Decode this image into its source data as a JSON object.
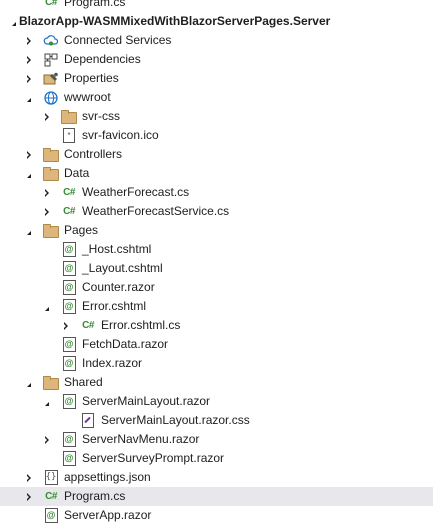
{
  "solution_explorer": {
    "items": [
      {
        "label": "Program.cs",
        "depth": 1,
        "icon": "csharp-file-icon",
        "expander": "none"
      },
      {
        "label": "BlazorApp-WASMMixedWithBlazorServerPages.Server",
        "depth": 0,
        "icon": "project-icon",
        "expander": "expanded",
        "bold": true
      },
      {
        "label": "Connected Services",
        "depth": 1,
        "icon": "connected-services-icon",
        "expander": "collapsed"
      },
      {
        "label": "Dependencies",
        "depth": 1,
        "icon": "dependencies-icon",
        "expander": "collapsed"
      },
      {
        "label": "Properties",
        "depth": 1,
        "icon": "properties-icon",
        "expander": "collapsed"
      },
      {
        "label": "wwwroot",
        "depth": 1,
        "icon": "globe-icon",
        "expander": "expanded"
      },
      {
        "label": "svr-css",
        "depth": 2,
        "icon": "folder-icon",
        "expander": "collapsed"
      },
      {
        "label": "svr-favicon.ico",
        "depth": 2,
        "icon": "favicon-file-icon",
        "expander": "none"
      },
      {
        "label": "Controllers",
        "depth": 1,
        "icon": "folder-icon",
        "expander": "collapsed"
      },
      {
        "label": "Data",
        "depth": 1,
        "icon": "folder-icon",
        "expander": "expanded"
      },
      {
        "label": "WeatherForecast.cs",
        "depth": 2,
        "icon": "csharp-file-icon",
        "expander": "collapsed"
      },
      {
        "label": "WeatherForecastService.cs",
        "depth": 2,
        "icon": "csharp-file-icon",
        "expander": "collapsed"
      },
      {
        "label": "Pages",
        "depth": 1,
        "icon": "folder-icon",
        "expander": "expanded"
      },
      {
        "label": "_Host.cshtml",
        "depth": 2,
        "icon": "razor-file-icon",
        "expander": "none"
      },
      {
        "label": "_Layout.cshtml",
        "depth": 2,
        "icon": "razor-file-icon",
        "expander": "none"
      },
      {
        "label": "Counter.razor",
        "depth": 2,
        "icon": "razor-file-icon",
        "expander": "none"
      },
      {
        "label": "Error.cshtml",
        "depth": 2,
        "icon": "razor-file-icon",
        "expander": "expanded"
      },
      {
        "label": "Error.cshtml.cs",
        "depth": 3,
        "icon": "csharp-file-icon",
        "expander": "collapsed"
      },
      {
        "label": "FetchData.razor",
        "depth": 2,
        "icon": "razor-file-icon",
        "expander": "none"
      },
      {
        "label": "Index.razor",
        "depth": 2,
        "icon": "razor-file-icon",
        "expander": "none"
      },
      {
        "label": "Shared",
        "depth": 1,
        "icon": "folder-icon",
        "expander": "expanded"
      },
      {
        "label": "ServerMainLayout.razor",
        "depth": 2,
        "icon": "razor-file-icon",
        "expander": "expanded"
      },
      {
        "label": "ServerMainLayout.razor.css",
        "depth": 3,
        "icon": "css-file-icon",
        "expander": "none"
      },
      {
        "label": "ServerNavMenu.razor",
        "depth": 2,
        "icon": "razor-file-icon",
        "expander": "collapsed"
      },
      {
        "label": "ServerSurveyPrompt.razor",
        "depth": 2,
        "icon": "razor-file-icon",
        "expander": "none"
      },
      {
        "label": "appsettings.json",
        "depth": 1,
        "icon": "json-file-icon",
        "expander": "collapsed"
      },
      {
        "label": "Program.cs",
        "depth": 1,
        "icon": "csharp-file-icon",
        "expander": "collapsed",
        "selected": true
      },
      {
        "label": "ServerApp.razor",
        "depth": 1,
        "icon": "razor-file-icon",
        "expander": "none"
      }
    ]
  },
  "colors": {
    "selection": "#e8e8ec",
    "csharp_green": "#388a34",
    "folder": "#dcb67a"
  }
}
